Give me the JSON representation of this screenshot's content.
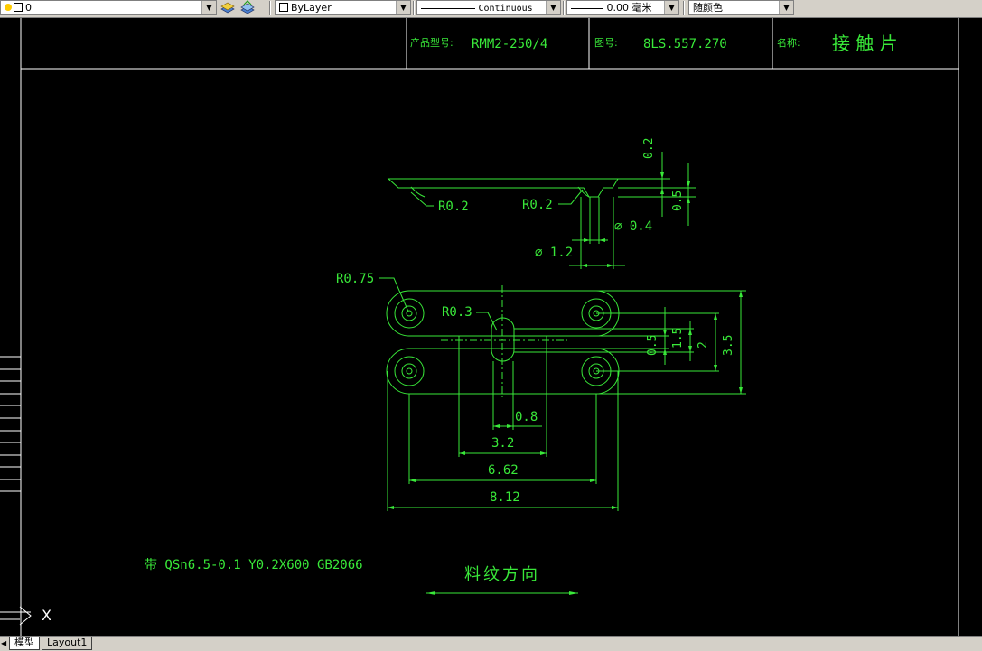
{
  "toolbar": {
    "layer_value": "0",
    "color_value": "ByLayer",
    "linetype_value": "Continuous",
    "lineweight_value": "0.00 毫米",
    "plotstyle_value": "随颜色"
  },
  "title_block": {
    "product_label": "产品型号:",
    "product_value": "RMM2-250/4",
    "drawing_no_label": "图号:",
    "drawing_no_value": "8LS.557.270",
    "name_label": "名称:",
    "name_value": "接 触 片"
  },
  "dimensions": {
    "r02_left": "R0.2",
    "r02_right": "R0.2",
    "dia04": "∅ 0.4",
    "dia12": "∅ 1.2",
    "r075": "R0.75",
    "r03": "R0.3",
    "d02": "0.2",
    "d05_top": "0.5",
    "d05_mid": "0.5",
    "d15": "1.5",
    "d2": "2",
    "d35": "3.5",
    "d08": "0.8",
    "d32": "3.2",
    "d662": "6.62",
    "d812": "8.12"
  },
  "notes": {
    "material": "带 QSn6.5-0.1 Y0.2X600 GB2066",
    "grain_direction": "料纹方向"
  },
  "ucs": {
    "x_label": "X"
  },
  "tabs": [
    {
      "label": "模型"
    },
    {
      "label": "Layout1"
    }
  ],
  "colors": {
    "drawing_green": "#39e839",
    "background": "#000000",
    "frame_white": "#ffffff"
  }
}
